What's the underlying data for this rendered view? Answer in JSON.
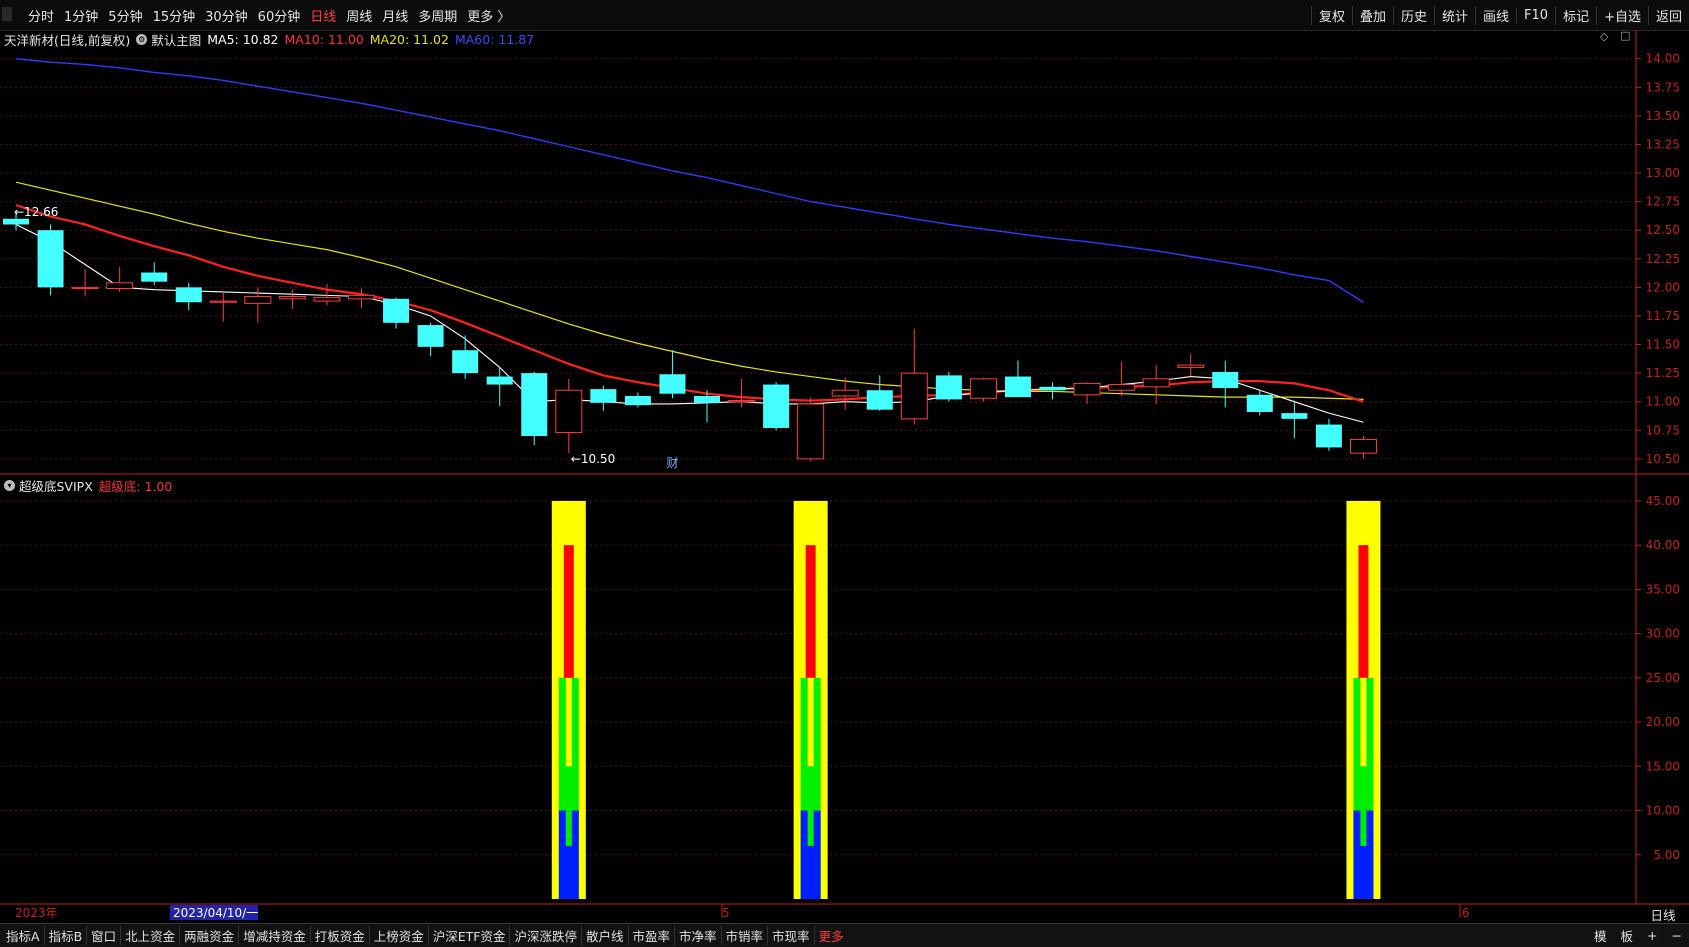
{
  "toolbar": {
    "tabs": [
      "分时",
      "1分钟",
      "5分钟",
      "15分钟",
      "30分钟",
      "60分钟",
      "日线",
      "周线",
      "月线",
      "多周期",
      "更多 〉"
    ],
    "active_tab": "日线",
    "right_tools": [
      "复权",
      "叠加",
      "历史",
      "统计",
      "画线",
      "F10",
      "标记",
      "+自选",
      "返回"
    ]
  },
  "main_legend": {
    "stock": "天洋新材(日线,前复权)",
    "chart_name": "默认主图",
    "ma5": "MA5: 10.82",
    "ma10": "MA10: 11.00",
    "ma20": "MA20: 11.02",
    "ma60": "MA60: 11.87"
  },
  "sub_legend": {
    "indicator": "超级底SVIPX",
    "value": "超级底: 1.00"
  },
  "annotations": {
    "high": "←12.66",
    "low": "←10.50",
    "cai": "财"
  },
  "date_axis": {
    "year": "2023年",
    "cursor_date": "2023/04/10/一",
    "month5": "5",
    "month6": "6"
  },
  "period_label": "日线",
  "bottom_tabs": [
    "指标A",
    "指标B",
    "窗口",
    "北上资金",
    "两融资金",
    "增减持资金",
    "打板资金",
    "上榜资金",
    "沪深ETF资金",
    "沪深涨跌停",
    "散户线",
    "市盈率",
    "市净率",
    "市销率",
    "市现率",
    "更多"
  ],
  "bottom_right": [
    "模",
    "板",
    "+",
    "−"
  ],
  "colors": {
    "up": "#ff3c3c",
    "down": "#44ffff",
    "ma5": "#ffffff",
    "ma10": "#ff2020",
    "ma20": "#e6e600",
    "ma60": "#2d3cff",
    "axis": "#c81e1e"
  },
  "chart_data": [
    {
      "type": "candlestick",
      "yaxis_ticks": [
        "14.00",
        "13.75",
        "13.50",
        "13.25",
        "13.00",
        "12.75",
        "12.50",
        "12.25",
        "12.00",
        "11.75",
        "11.50",
        "11.25",
        "11.00",
        "10.75",
        "10.50"
      ],
      "ylim": [
        10.42,
        14.05
      ],
      "candles": [
        {
          "o": 12.6,
          "h": 12.66,
          "l": 12.5,
          "c": 12.55
        },
        {
          "o": 12.5,
          "h": 12.55,
          "l": 11.93,
          "c": 12.0
        },
        {
          "o": 12.0,
          "h": 12.16,
          "l": 11.92,
          "c": 12.0
        },
        {
          "o": 11.99,
          "h": 12.18,
          "l": 11.96,
          "c": 12.04
        },
        {
          "o": 12.13,
          "h": 12.22,
          "l": 12.02,
          "c": 12.05
        },
        {
          "o": 12.0,
          "h": 12.04,
          "l": 11.8,
          "c": 11.87
        },
        {
          "o": 11.88,
          "h": 11.97,
          "l": 11.7,
          "c": 11.88
        },
        {
          "o": 11.86,
          "h": 12.0,
          "l": 11.69,
          "c": 11.92
        },
        {
          "o": 11.9,
          "h": 11.98,
          "l": 11.81,
          "c": 11.92
        },
        {
          "o": 11.88,
          "h": 12.03,
          "l": 11.84,
          "c": 11.91
        },
        {
          "o": 11.9,
          "h": 11.99,
          "l": 11.82,
          "c": 11.93
        },
        {
          "o": 11.9,
          "h": 11.91,
          "l": 11.64,
          "c": 11.69
        },
        {
          "o": 11.67,
          "h": 11.69,
          "l": 11.4,
          "c": 11.48
        },
        {
          "o": 11.45,
          "h": 11.58,
          "l": 11.2,
          "c": 11.25
        },
        {
          "o": 11.22,
          "h": 11.3,
          "l": 10.96,
          "c": 11.15
        },
        {
          "o": 11.25,
          "h": 11.26,
          "l": 10.62,
          "c": 10.7
        },
        {
          "o": 10.73,
          "h": 11.2,
          "l": 10.55,
          "c": 11.1
        },
        {
          "o": 11.11,
          "h": 11.14,
          "l": 10.92,
          "c": 10.99
        },
        {
          "o": 11.05,
          "h": 11.08,
          "l": 10.95,
          "c": 10.97
        },
        {
          "o": 11.24,
          "h": 11.45,
          "l": 11.03,
          "c": 11.07
        },
        {
          "o": 11.05,
          "h": 11.1,
          "l": 10.82,
          "c": 10.99
        },
        {
          "o": 11.0,
          "h": 11.2,
          "l": 10.95,
          "c": 11.01
        },
        {
          "o": 11.15,
          "h": 11.17,
          "l": 10.75,
          "c": 10.77
        },
        {
          "o": 10.5,
          "h": 11.04,
          "l": 10.48,
          "c": 10.98
        },
        {
          "o": 11.05,
          "h": 11.21,
          "l": 10.93,
          "c": 11.1
        },
        {
          "o": 11.1,
          "h": 11.23,
          "l": 10.92,
          "c": 10.93
        },
        {
          "o": 10.85,
          "h": 11.64,
          "l": 10.8,
          "c": 11.25
        },
        {
          "o": 11.23,
          "h": 11.26,
          "l": 11.0,
          "c": 11.02
        },
        {
          "o": 11.03,
          "h": 11.21,
          "l": 11.0,
          "c": 11.2
        },
        {
          "o": 11.22,
          "h": 11.36,
          "l": 11.06,
          "c": 11.04
        },
        {
          "o": 11.13,
          "h": 11.17,
          "l": 11.02,
          "c": 11.1
        },
        {
          "o": 11.06,
          "h": 11.17,
          "l": 10.98,
          "c": 11.16
        },
        {
          "o": 11.1,
          "h": 11.35,
          "l": 11.05,
          "c": 11.15
        },
        {
          "o": 11.13,
          "h": 11.32,
          "l": 10.98,
          "c": 11.2
        },
        {
          "o": 11.3,
          "h": 11.42,
          "l": 11.22,
          "c": 11.32
        },
        {
          "o": 11.26,
          "h": 11.36,
          "l": 10.95,
          "c": 11.12
        },
        {
          "o": 11.06,
          "h": 11.1,
          "l": 10.88,
          "c": 10.91
        },
        {
          "o": 10.9,
          "h": 11.01,
          "l": 10.68,
          "c": 10.85
        },
        {
          "o": 10.8,
          "h": 10.85,
          "l": 10.57,
          "c": 10.6
        },
        {
          "o": 10.55,
          "h": 10.7,
          "l": 10.5,
          "c": 10.67
        }
      ],
      "ma5": [
        12.55,
        12.4,
        12.2,
        12.0,
        11.98,
        11.97,
        11.96,
        11.95,
        11.94,
        11.93,
        11.92,
        11.85,
        11.75,
        11.55,
        11.3,
        11.0,
        11.02,
        11.0,
        10.98,
        10.98,
        10.99,
        11.0,
        10.98,
        10.98,
        11.0,
        10.99,
        11.0,
        11.05,
        11.08,
        11.1,
        11.11,
        11.12,
        11.15,
        11.18,
        11.22,
        11.2,
        11.1,
        11.0,
        10.9,
        10.82
      ],
      "ma10": [
        12.72,
        12.62,
        12.55,
        12.45,
        12.36,
        12.28,
        12.18,
        12.1,
        12.04,
        11.98,
        11.94,
        11.88,
        11.8,
        11.69,
        11.57,
        11.45,
        11.33,
        11.23,
        11.17,
        11.12,
        11.07,
        11.04,
        11.02,
        11.01,
        11.02,
        11.04,
        11.05,
        11.06,
        11.08,
        11.1,
        11.11,
        11.12,
        11.13,
        11.14,
        11.17,
        11.18,
        11.18,
        11.16,
        11.1,
        11.0
      ],
      "ma20": [
        12.92,
        12.85,
        12.78,
        12.71,
        12.64,
        12.56,
        12.49,
        12.43,
        12.38,
        12.33,
        12.26,
        12.18,
        12.08,
        11.98,
        11.88,
        11.78,
        11.68,
        11.59,
        11.51,
        11.44,
        11.37,
        11.31,
        11.26,
        11.22,
        11.18,
        11.15,
        11.13,
        11.11,
        11.1,
        11.09,
        11.09,
        11.08,
        11.07,
        11.06,
        11.05,
        11.04,
        11.04,
        11.04,
        11.03,
        11.02
      ],
      "ma60": [
        14.0,
        13.97,
        13.95,
        13.92,
        13.88,
        13.85,
        13.81,
        13.76,
        13.71,
        13.66,
        13.61,
        13.55,
        13.49,
        13.43,
        13.37,
        13.3,
        13.23,
        13.16,
        13.09,
        13.02,
        12.96,
        12.89,
        12.82,
        12.75,
        12.7,
        12.65,
        12.6,
        12.55,
        12.51,
        12.47,
        12.43,
        12.4,
        12.36,
        12.32,
        12.27,
        12.22,
        12.17,
        12.11,
        12.06,
        11.87
      ]
    },
    {
      "type": "bar",
      "name": "超级底SVIPX",
      "yaxis_ticks": [
        "45.00",
        "40.00",
        "35.00",
        "30.00",
        "25.00",
        "20.00",
        "15.00",
        "10.00",
        "5.00"
      ],
      "ylim": [
        0,
        46.8
      ],
      "signal_indices": [
        16,
        23,
        39
      ],
      "layers": [
        {
          "color": "#ffff00",
          "bottom": 0,
          "top": 45,
          "width": 34
        },
        {
          "color": "#ff0000",
          "bottom": 0,
          "top": 40,
          "width": 10
        },
        {
          "color": "#00ee00",
          "bottom": 0,
          "top": 25,
          "width": 20
        },
        {
          "color": "#ffff00",
          "bottom": 15,
          "top": 25,
          "width": 6
        },
        {
          "color": "#0020ff",
          "bottom": 0,
          "top": 10,
          "width": 20
        },
        {
          "color": "#00ee00",
          "bottom": 6,
          "top": 10,
          "width": 6
        }
      ]
    }
  ]
}
